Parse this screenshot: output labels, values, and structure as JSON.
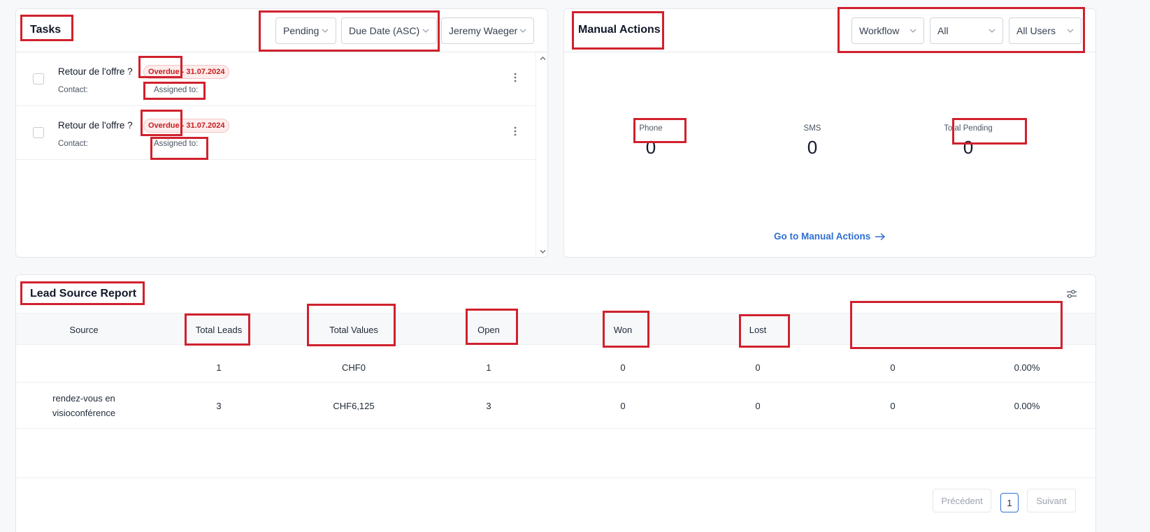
{
  "tasks": {
    "title": "Tasks",
    "filters": {
      "status": "Pending",
      "sort": "Due Date (ASC)",
      "user": "Jeremy Waeger"
    },
    "items": [
      {
        "title": "Retour de l'offre ?",
        "badge": "Overdue - 31.07.2024",
        "contact_label": "Contact:",
        "assigned_label": "Assigned to:"
      },
      {
        "title": "Retour de l'offre ?",
        "badge": "Overdue - 31.07.2024",
        "contact_label": "Contact:",
        "assigned_label": "Assigned to:"
      }
    ]
  },
  "manual_actions": {
    "title": "Manual Actions",
    "filters": {
      "type": "Workflow",
      "scope": "All",
      "users": "All Users"
    },
    "stats": [
      {
        "label": "Phone",
        "value": "0"
      },
      {
        "label": "SMS",
        "value": "0"
      },
      {
        "label": "Total Pending",
        "value": "0"
      }
    ],
    "link": "Go to Manual Actions"
  },
  "lead_source": {
    "title": "Lead Source Report",
    "columns": [
      "Source",
      "Total Leads",
      "Total Values",
      "Open",
      "Won",
      "Lost",
      "",
      ""
    ],
    "rows": [
      {
        "source": "",
        "total_leads": "1",
        "total_values": "CHF0",
        "open": "1",
        "won": "0",
        "lost": "0",
        "col7": "0",
        "col8": "0.00%"
      },
      {
        "source_line1": "rendez-vous en",
        "source_line2": "visioconférence",
        "total_leads": "3",
        "total_values": "CHF6,125",
        "open": "3",
        "won": "0",
        "lost": "0",
        "col7": "0",
        "col8": "0.00%"
      }
    ],
    "pagination": {
      "prev": "Précédent",
      "page": "1",
      "next": "Suivant"
    }
  },
  "colors": {
    "accent": "#2f6fd1",
    "overdue": "#c81e1e",
    "annotation": "#d0212d"
  }
}
